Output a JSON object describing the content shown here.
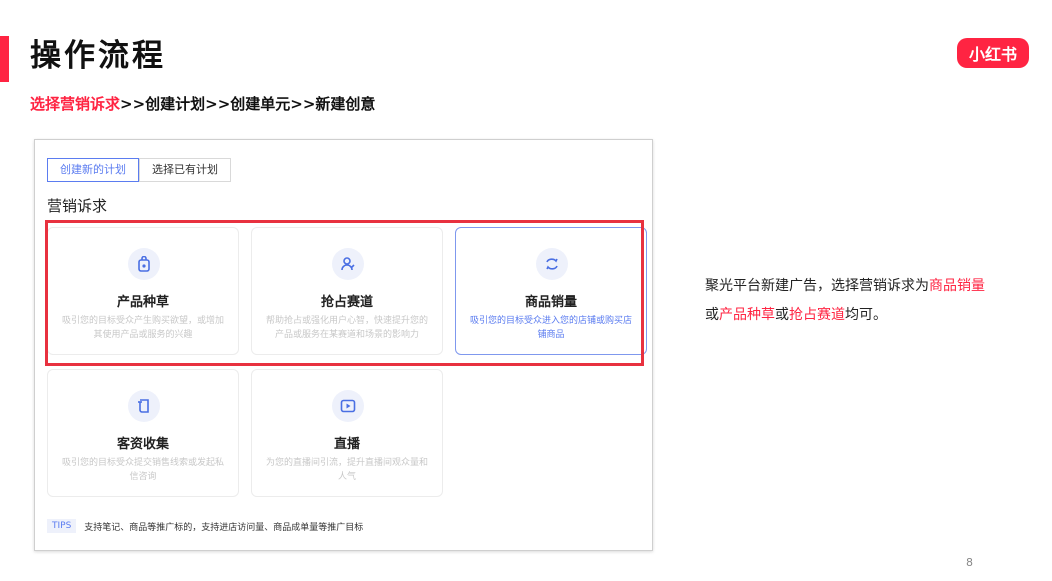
{
  "header": {
    "title": "操作流程",
    "logo_text": "小红书",
    "steps_highlight": "选择营销诉求",
    "steps_rest": ">>创建计划>>创建单元>>新建创意"
  },
  "screenshot": {
    "tabs": [
      {
        "label": "创建新的计划",
        "active": true
      },
      {
        "label": "选择已有计划",
        "active": false
      }
    ],
    "section_label": "营销诉求",
    "cards": [
      {
        "icon": "product-seed-icon",
        "title": "产品种草",
        "desc": "吸引您的目标受众产生购买欲望，或增加其使用产品或服务的兴趣"
      },
      {
        "icon": "user-lane-icon",
        "title": "抢占赛道",
        "desc": "帮助抢占或强化用户心智，快速提升您的产品或服务在某赛道和场景的影响力"
      },
      {
        "icon": "refresh-sales-icon",
        "title": "商品销量",
        "desc": "吸引您的目标受众进入您的店铺或购买店铺商品",
        "selected": true
      },
      {
        "icon": "lead-collect-icon",
        "title": "客资收集",
        "desc": "吸引您的目标受众提交销售线索或发起私信咨询"
      },
      {
        "icon": "live-play-icon",
        "title": "直播",
        "desc": "为您的直播间引流，提升直播间观众量和人气"
      }
    ],
    "tips_tag": "TIPS",
    "tips_text": "支持笔记、商品等推广标的，支持进店访问量、商品成单量等推广目标"
  },
  "explanation": {
    "prefix": "聚光平台新建广告，选择营销诉求为",
    "hl1": "商品销量",
    "mid1": "或",
    "hl2": "产品种草",
    "mid2": "或",
    "hl3": "抢占赛道",
    "suffix": "均可。"
  },
  "footer": {
    "page_number": "8"
  },
  "colors": {
    "brand_red": "#ff2442",
    "highlight_box": "#e8313f",
    "accent_blue": "#5b7cf0"
  }
}
